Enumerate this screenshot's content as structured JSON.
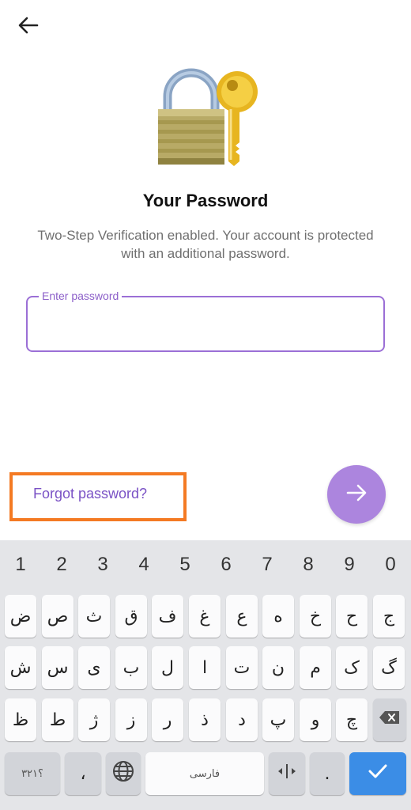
{
  "header": {
    "back_icon": "arrow-left-icon"
  },
  "hero": {
    "icon": "lock-and-key-icon"
  },
  "title": "Your Password",
  "subtitle": "Two-Step Verification enabled. Your account is protected with an additional password.",
  "password_field": {
    "label": "Enter password",
    "value": ""
  },
  "forgot_link": "Forgot password?",
  "next_button": {
    "icon": "arrow-right-icon"
  },
  "colors": {
    "accent": "#9b6fd6",
    "fab": "#ac85de",
    "highlight": "#f47a23",
    "enter_key": "#3b8de6"
  },
  "keyboard": {
    "numbers": [
      "1",
      "2",
      "3",
      "4",
      "5",
      "6",
      "7",
      "8",
      "9",
      "0"
    ],
    "row1": [
      "ض",
      "ص",
      "ث",
      "ق",
      "ف",
      "غ",
      "ع",
      "ه",
      "خ",
      "ح",
      "ج"
    ],
    "row2": [
      "ش",
      "س",
      "ی",
      "ب",
      "ل",
      "ا",
      "ت",
      "ن",
      "م",
      "ک",
      "گ"
    ],
    "row3": [
      "ظ",
      "ط",
      "ژ",
      "ز",
      "ر",
      "ذ",
      "د",
      "پ",
      "و",
      "چ"
    ],
    "bottom": {
      "symbols_label": "؟۳۲۱",
      "comma": "،",
      "space_label": "فارسی",
      "period": ".",
      "globe_icon": "globe-icon",
      "cursor_icon": "cursor-move-icon",
      "backspace_icon": "backspace-icon",
      "enter_icon": "check-icon"
    }
  }
}
